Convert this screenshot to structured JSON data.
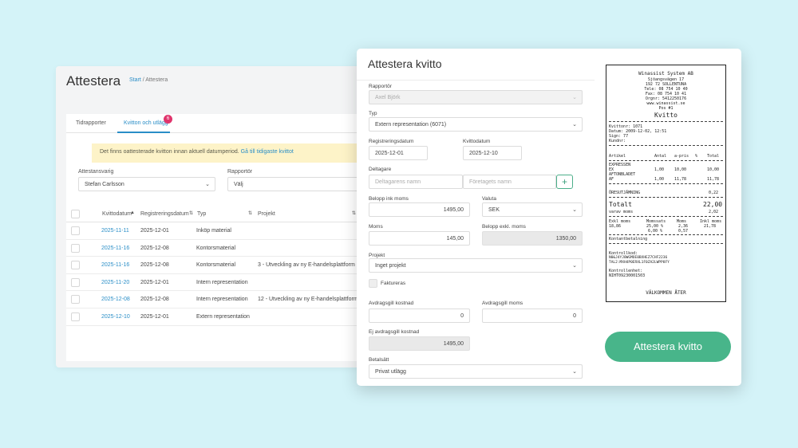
{
  "bg": {
    "title": "Attestera",
    "breadcrumb_link": "Start",
    "breadcrumb_current": "/ Attestera",
    "tabs": [
      {
        "label": "Tidrapporter"
      },
      {
        "label": "Kvitton och utlägg"
      }
    ],
    "tab_badge": "6",
    "alert_text": "Det finns oattesterade kvitton innan aktuell datumperiod.",
    "alert_link": "Gå till tidigaste kvittot",
    "filters": {
      "attestant_label": "Attestansvarig",
      "attestant_value": "Stefan Carlsson",
      "reporter_label": "Rapportör",
      "reporter_value": "Välj"
    },
    "columns": [
      "Kvittodatum",
      "Registreringsdatum",
      "Typ",
      "Projekt"
    ],
    "rows": [
      {
        "receipt_date": "2025-11-11",
        "reg_date": "2025-12-01",
        "type": "Inköp material",
        "project": ""
      },
      {
        "receipt_date": "2025-11-16",
        "reg_date": "2025-12-08",
        "type": "Kontorsmaterial",
        "project": ""
      },
      {
        "receipt_date": "2025-11-16",
        "reg_date": "2025-12-08",
        "type": "Kontorsmaterial",
        "project": "3 - Utveckling av ny E-handelsplattform"
      },
      {
        "receipt_date": "2025-11-20",
        "reg_date": "2025-12-01",
        "type": "Intern representation",
        "project": ""
      },
      {
        "receipt_date": "2025-12-08",
        "reg_date": "2025-12-08",
        "type": "Intern representation",
        "project": "12 - Utveckling av ny E-handelsplattform"
      },
      {
        "receipt_date": "2025-12-10",
        "reg_date": "2025-12-01",
        "type": "Extern representation",
        "project": ""
      }
    ]
  },
  "modal": {
    "title": "Attestera kvitto",
    "reporter_label": "Rapportör",
    "reporter_value": "Axel Björk",
    "type_label": "Typ",
    "type_value": "Extern representation (6071)",
    "reg_date_label": "Registreringsdatum",
    "reg_date_value": "2025-12-01",
    "receipt_date_label": "Kvittodatum",
    "receipt_date_value": "2025-12-10",
    "participants_label": "Deltagare",
    "participant_name_placeholder": "Deltagarens namn",
    "company_name_placeholder": "Företagets namn",
    "plus_label": "+",
    "amount_label": "Belopp ink moms",
    "amount_value": "1495,00",
    "currency_label": "Valuta",
    "currency_value": "SEK",
    "vat_label": "Moms",
    "vat_value": "145,00",
    "amount_excl_label": "Belopp exkl. moms",
    "amount_excl_value": "1350,00",
    "project_label": "Projekt",
    "project_value": "Inget projekt",
    "invoiced_label": "Faktureras",
    "deductible_cost_label": "Avdragsgill kostnad",
    "deductible_cost_value": "0",
    "deductible_vat_label": "Avdragsgill moms",
    "deductible_vat_value": "0",
    "nondeductible_label": "Ej avdragsgill kostnad",
    "nondeductible_value": "1495,00",
    "payment_label": "Betalsätt",
    "payment_value": "Privat utlägg",
    "approve_button": "Attestera kvitto"
  },
  "receipt": {
    "header": [
      "Winassist System AB",
      "Sjöangsvägen 17",
      "192 72 SOLLENTUNA",
      "Tele: 08 754 10 40",
      "Fax: 08 754 10 41",
      "Orgnr: 5412250176",
      "www.winassist.se",
      "Pos #1"
    ],
    "title": "Kvitto",
    "meta": [
      "Kvittonr: 1071",
      "Datum: 2009-12-02, 12:51",
      "Sign: 77",
      "Kundnr:"
    ],
    "col_headers": [
      "Artikel",
      "Antal",
      "a-pris",
      "%",
      "Total"
    ],
    "items": [
      {
        "name": "EXPRESSEN",
        "qty": "",
        "price": "",
        "pct": "",
        "total": ""
      },
      {
        "name": "EX",
        "qty": "1,00",
        "price": "10,00",
        "pct": "",
        "total": "10,00"
      },
      {
        "name": "AFTONBLADET",
        "qty": "",
        "price": "",
        "pct": "",
        "total": ""
      },
      {
        "name": "AF",
        "qty": "1,00",
        "price": "11,78",
        "pct": "",
        "total": "11,78"
      }
    ],
    "rounding_label": "ÖRESUTJÄMNING",
    "rounding_value": "0,22",
    "total_label": "Totalt",
    "total_value": "22,00",
    "vat_line_label": "varav moms",
    "vat_line_value": "2,02",
    "vat_headers": [
      "Exkl moms",
      "Momssats",
      "Moms",
      "Inkl moms"
    ],
    "vat_rows": [
      [
        "18,86",
        "25,00 %",
        "2,36",
        "21,78"
      ],
      [
        "",
        "6,00 %",
        "0,57",
        ""
      ]
    ],
    "payment": "Kontantbetalning",
    "control_code_label": "Kontrollkod:",
    "control_code_1": "N0&J4YJ0WGMOE0BXHEZ7CHF2236",
    "control_code_2": "TAL2:MXH4P0ERXL1F0ZA2LWPP8FY",
    "control_unit_label": "Kontrollenhet:",
    "control_unit_value": "NIHT09230001503",
    "footer": "VÄLKOMMEN ÅTER"
  }
}
